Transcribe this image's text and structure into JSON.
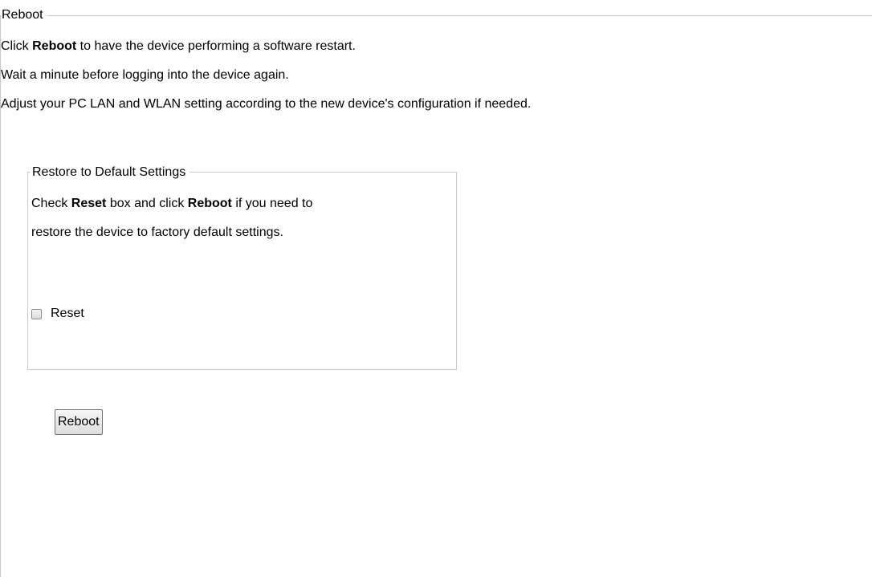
{
  "reboot_section": {
    "legend": "Reboot",
    "line1": {
      "pre": "Click ",
      "bold": "Reboot",
      "post": " to have the device performing a software restart."
    },
    "line2": "Wait a minute before logging into the device again.",
    "line3": "Adjust your PC LAN and WLAN setting according to the new device's configuration if needed."
  },
  "restore_section": {
    "legend": "Restore to Default Settings",
    "line1": {
      "pre": "Check ",
      "bold1": "Reset",
      "mid": " box and click ",
      "bold2": "Reboot",
      "post": " if you need to"
    },
    "line2": "restore the device to factory default settings.",
    "reset_label": "Reset",
    "reset_checked": false
  },
  "reboot_button_label": "Reboot"
}
